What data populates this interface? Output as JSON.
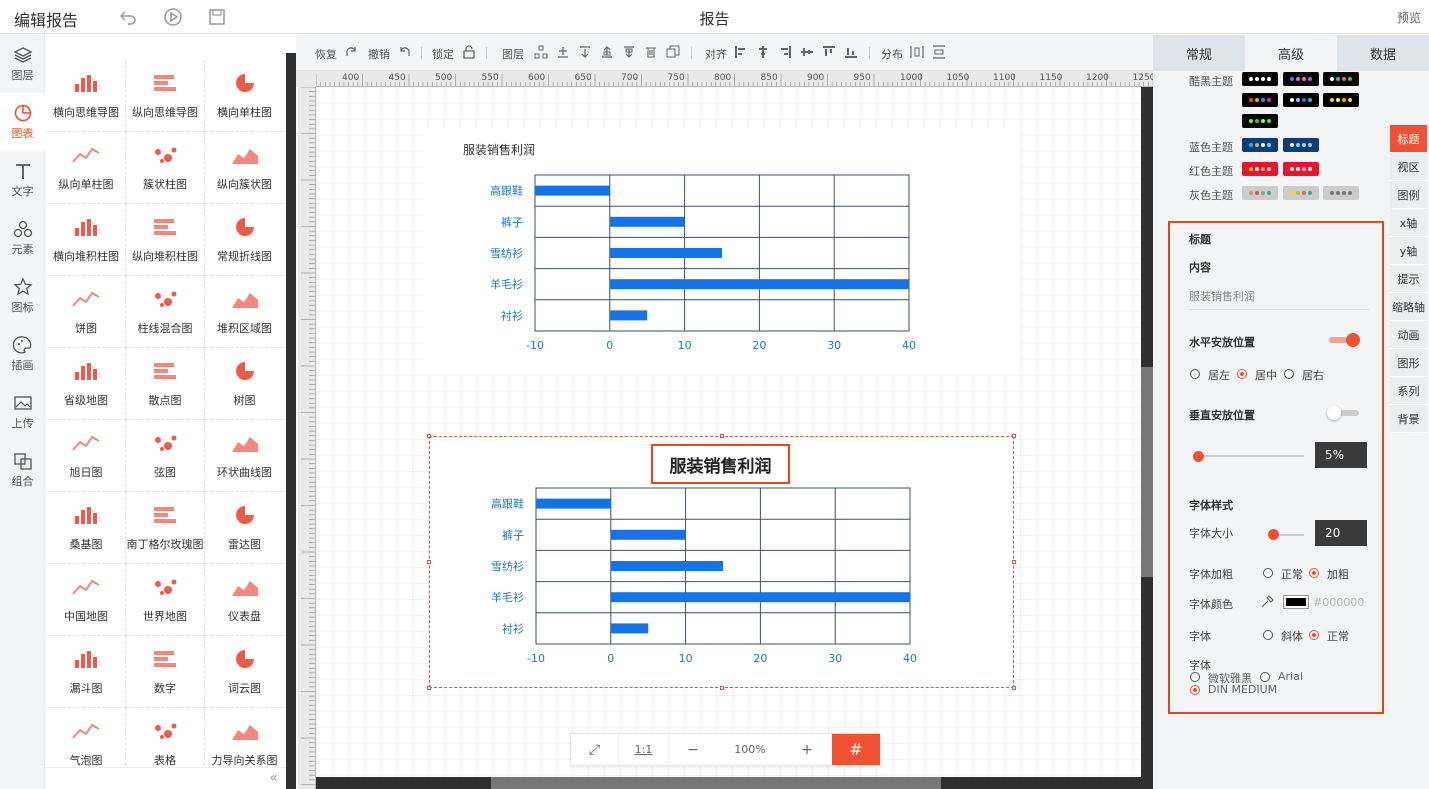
{
  "app": {
    "title": "编辑报告",
    "report_title": "报告",
    "preview": "预览"
  },
  "left_nav": [
    {
      "label": "图层",
      "icon": "layers-icon"
    },
    {
      "label": "图表",
      "icon": "chart-icon",
      "active": true
    },
    {
      "label": "文字",
      "icon": "text-icon"
    },
    {
      "label": "元素",
      "icon": "shapes-icon"
    },
    {
      "label": "图标",
      "icon": "star-icon"
    },
    {
      "label": "插画",
      "icon": "palette-icon"
    },
    {
      "label": "上传",
      "icon": "image-upload-icon"
    },
    {
      "label": "组合",
      "icon": "group-icon"
    }
  ],
  "chart_types": [
    "横向思维导图",
    "纵向思维导图",
    "横向单柱图",
    "纵向单柱图",
    "簇状柱图",
    "纵向簇状图",
    "横向堆积柱图",
    "纵向堆积柱图",
    "常规折线图",
    "饼图",
    "柱线混合图",
    "堆积区域图",
    "省级地图",
    "散点图",
    "树图",
    "旭日图",
    "弦图",
    "环状曲线图",
    "桑基图",
    "南丁格尔玫瑰图",
    "雷达图",
    "中国地图",
    "世界地图",
    "仪表盘",
    "漏斗图",
    "数字",
    "词云图",
    "气泡图",
    "表格",
    "力导向关系图"
  ],
  "toolbar": {
    "restore": "恢复",
    "undo": "撤销",
    "lock": "锁定",
    "layer": "图层",
    "align": "对齐",
    "distribute": "分布"
  },
  "ruler": {
    "ticks": [
      "400",
      "450",
      "500",
      "550",
      "600",
      "650",
      "700",
      "750",
      "800",
      "850",
      "900",
      "950",
      "1000",
      "1050",
      "1100",
      "1150",
      "1200",
      "1250"
    ]
  },
  "charts": {
    "chart1_title": "服装销售利润",
    "chart2_title": "服装销售利润"
  },
  "chart_data": [
    {
      "type": "bar",
      "orientation": "horizontal",
      "title": "服装销售利润",
      "categories": [
        "高跟鞋",
        "裤子",
        "雪纺衫",
        "羊毛衫",
        "衬衫"
      ],
      "values": [
        -10,
        10,
        15,
        40,
        5
      ],
      "xlim": [
        -10,
        40
      ],
      "xticks": [
        "-10",
        "0",
        "10",
        "20",
        "30",
        "40"
      ],
      "bar_color": "#1473e6",
      "grid": true
    },
    {
      "type": "bar",
      "orientation": "horizontal",
      "title": "服装销售利润",
      "categories": [
        "高跟鞋",
        "裤子",
        "雪纺衫",
        "羊毛衫",
        "衬衫"
      ],
      "values": [
        -10,
        10,
        15,
        40,
        5
      ],
      "xlim": [
        -10,
        40
      ],
      "xticks": [
        "-10",
        "0",
        "10",
        "20",
        "30",
        "40"
      ],
      "bar_color": "#1473e6",
      "grid": true
    }
  ],
  "zoom": {
    "fit": "⤢",
    "one_to_one": "1:1",
    "minus": "−",
    "value": "100%",
    "plus": "+",
    "grid": "#"
  },
  "right_panel": {
    "tabs": [
      "常规",
      "高级",
      "数据"
    ],
    "active_tab": "高级",
    "themes": [
      {
        "label": "酷黑主题"
      },
      {
        "label": "蓝色主题"
      },
      {
        "label": "红色主题"
      },
      {
        "label": "灰色主题"
      }
    ],
    "vtabs": [
      "标题",
      "视区",
      "图例",
      "x轴",
      "y轴",
      "提示",
      "缩略轴",
      "动画",
      "图形",
      "系列",
      "背景"
    ],
    "form": {
      "section": "标题",
      "content_label": "内容",
      "content_value": "服装销售利润",
      "h_pos_label": "水平安放位置",
      "h_opts": [
        "居左",
        "居中",
        "居右"
      ],
      "v_pos_label": "垂直安放位置",
      "v_value": "5%",
      "font_style_label": "字体样式",
      "font_size_label": "字体大小",
      "font_size_value": "20",
      "bold_label": "字体加粗",
      "bold_opts": [
        "正常",
        "加粗"
      ],
      "color_label": "字体颜色",
      "color_value": "#000000",
      "italic_label": "字体",
      "italic_opts": [
        "斜体",
        "正常"
      ],
      "family_label": "字体",
      "family_opts": [
        "微软雅黑",
        "Arial",
        "DIN MEDIUM"
      ]
    }
  }
}
